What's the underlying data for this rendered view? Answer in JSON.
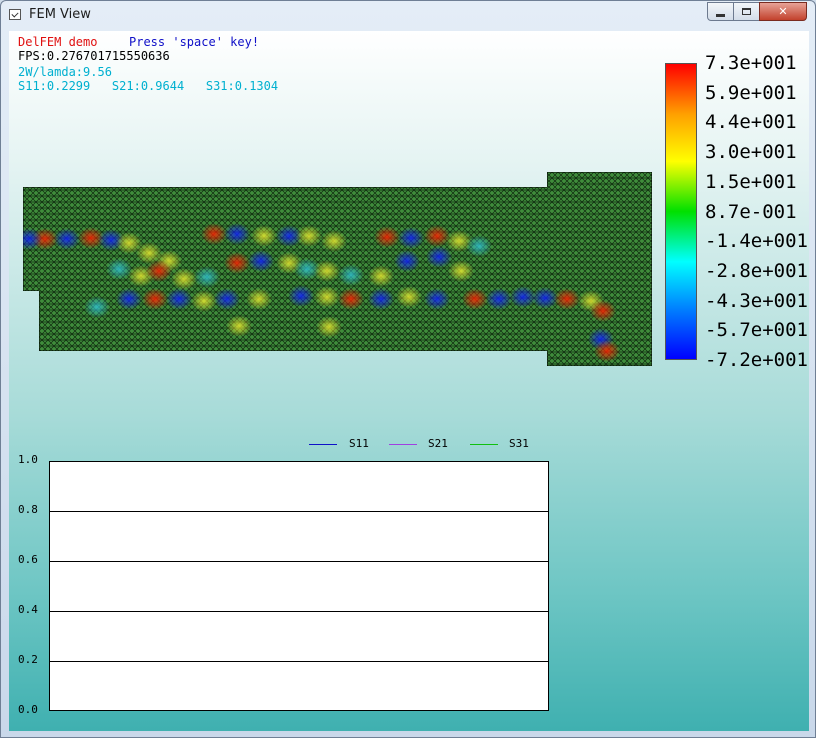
{
  "window": {
    "title": "FEM View"
  },
  "hud": {
    "demo_label": "DelFEM demo",
    "press_label": "Press 'space' key!",
    "fps_text": "FPS:0.276701715550636",
    "lamda_text": "2W/lamda:9.56",
    "s_params_text": "S11:0.2299   S21:0.9644   S31:0.1304"
  },
  "colors": {
    "demo": "#e01010",
    "press": "#1010c8",
    "info": "#00b0d0",
    "mesh_base": "#3e8a3a"
  },
  "colorbar": {
    "labels": [
      "7.3e+001",
      "5.9e+001",
      "4.4e+001",
      "3.0e+001",
      "1.5e+001",
      "8.7e-001",
      "-1.4e+001",
      "-2.8e+001",
      "-4.3e+001",
      "-5.7e+001",
      "-7.2e+001"
    ]
  },
  "chart_data": {
    "type": "line",
    "series": [
      {
        "name": "S11",
        "values": [],
        "color": "#1010c8"
      },
      {
        "name": "S21",
        "values": [],
        "color": "#a040e0"
      },
      {
        "name": "S31",
        "values": [],
        "color": "#10c010"
      }
    ],
    "yticks": [
      "1.0",
      "0.8",
      "0.6",
      "0.4",
      "0.2",
      "0.0"
    ],
    "ylim": [
      0.0,
      1.0
    ],
    "grid": true,
    "legend": "top"
  }
}
